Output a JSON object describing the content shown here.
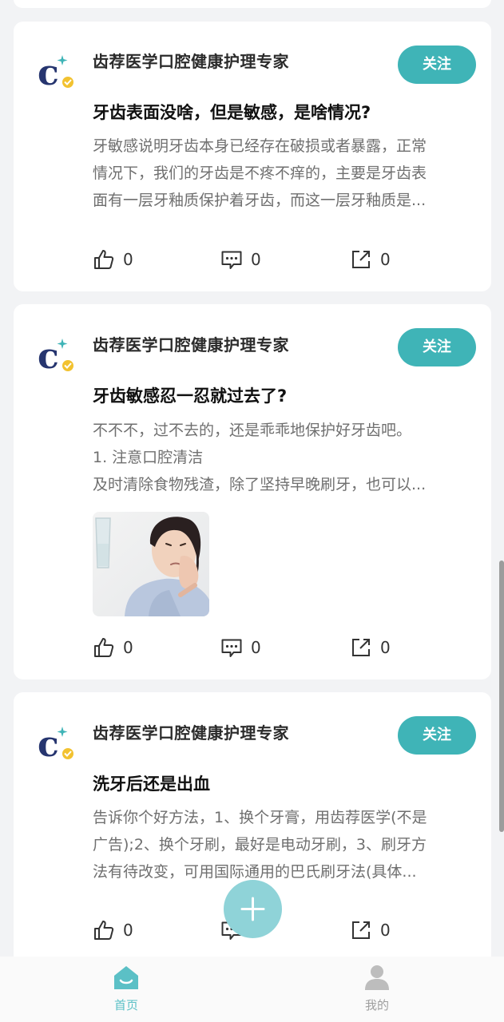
{
  "feed": {
    "posts": [
      {
        "author": "齿荐医学口腔健康护理专家",
        "follow_label": "关注",
        "title": "牙齿表面没啥，但是敏感，是啥情况?",
        "body_lines": [
          "牙敏感说明牙齿本身已经存在破损或者暴露，正常",
          "情况下，我们的牙齿是不疼不痒的，主要是牙齿表",
          "面有一层牙釉质保护着牙齿，而这一层牙釉质是..."
        ],
        "likes": "0",
        "comments": "0",
        "shares": "0",
        "has_image": false
      },
      {
        "author": "齿荐医学口腔健康护理专家",
        "follow_label": "关注",
        "title": "牙齿敏感忍一忍就过去了?",
        "body_lines": [
          "不不不，过不去的，还是乖乖地保护好牙齿吧。",
          "1. 注意口腔清洁",
          "及时清除食物残渣，除了坚持早晚刷牙，也可以..."
        ],
        "likes": "0",
        "comments": "0",
        "shares": "0",
        "has_image": true
      },
      {
        "author": "齿荐医学口腔健康护理专家",
        "follow_label": "关注",
        "title": "洗牙后还是出血",
        "body_lines": [
          "告诉你个好方法，1、换个牙膏，用齿荐医学(不是",
          "广告);2、换个牙刷，最好是电动牙刷，3、刷牙方",
          "法有待改变，可用国际通用的巴氏刷牙法(具体..."
        ],
        "likes": "0",
        "comments": "0",
        "shares": "0",
        "has_image": false
      }
    ]
  },
  "tabbar": {
    "home_label": "首页",
    "mine_label": "我的"
  },
  "colors": {
    "accent": "#3fb4b7",
    "fab": "#8fd3d8",
    "tab_active": "#5bc0c6",
    "tab_inactive": "#bdbdbd"
  },
  "icons": {
    "like": "thumb-up-icon",
    "comment": "comment-icon",
    "share": "share-icon",
    "add": "plus-icon",
    "home": "home-icon",
    "mine": "person-icon"
  }
}
